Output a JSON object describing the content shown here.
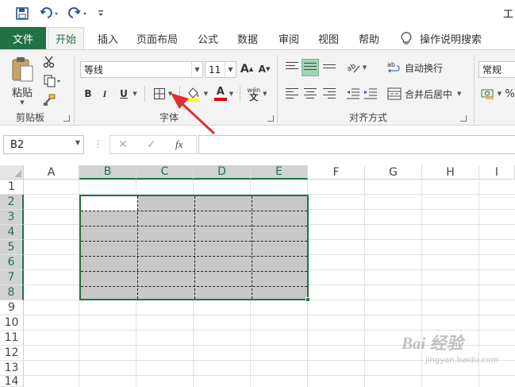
{
  "app": {
    "title_fragment": "工",
    "accent_color": "#217346"
  },
  "tabs": {
    "file": "文件",
    "items": [
      "开始",
      "插入",
      "页面布局",
      "公式",
      "数据",
      "审阅",
      "视图",
      "帮助"
    ],
    "active_index": 0,
    "tell_me": "操作说明搜索"
  },
  "ribbon": {
    "clipboard": {
      "paste": "粘贴",
      "group_label": "剪贴板"
    },
    "font": {
      "font_name": "等线",
      "font_size": "11",
      "bold": "B",
      "italic": "I",
      "underline": "U",
      "grow": "A",
      "shrink": "A",
      "font_color_glyph": "A",
      "phonetic": "wén",
      "group_label": "字体"
    },
    "alignment": {
      "wrap_text": "自动换行",
      "merge_center": "合并后居中",
      "group_label": "对齐方式"
    },
    "number": {
      "format": "常规"
    }
  },
  "formula_bar": {
    "name_box": "B2",
    "fx": "fx",
    "cancel": "✕",
    "enter": "✓",
    "more": "⋮",
    "content": ""
  },
  "sheet": {
    "columns": [
      "A",
      "B",
      "C",
      "D",
      "E",
      "F",
      "G",
      "H",
      "I"
    ],
    "rows": [
      "1",
      "2",
      "3",
      "4",
      "5",
      "6",
      "7",
      "8",
      "9",
      "10",
      "11",
      "12",
      "13",
      "14"
    ],
    "selected_range": "B2:E8",
    "selected_columns": [
      "B",
      "C",
      "D",
      "E"
    ],
    "selected_rows": [
      "2",
      "3",
      "4",
      "5",
      "6",
      "7",
      "8"
    ]
  },
  "icons": {
    "save": "save-icon",
    "undo": "undo-icon",
    "redo": "redo-icon",
    "customize": "customize-qat-icon",
    "border": "border-icon",
    "fill": "fill-color-icon",
    "font_color": "font-color-icon",
    "lightbulb": "lightbulb-icon"
  },
  "watermark": {
    "brand": "Bai 经验",
    "url": "jingyan.baidu.com"
  }
}
